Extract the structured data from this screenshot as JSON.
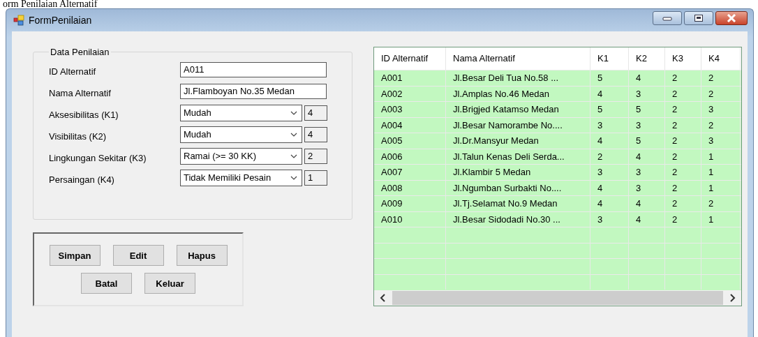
{
  "caption": "orm Penilaian Alternatif",
  "window": {
    "title": "FormPenilaian"
  },
  "group": {
    "title": "Data Penilaian",
    "fields": [
      {
        "kind": "text",
        "label": "ID Alternatif",
        "value": "A011"
      },
      {
        "kind": "text",
        "label": "Nama Alternatif",
        "value": "Jl.Flamboyan No.35 Medan"
      },
      {
        "kind": "combo",
        "label": "Aksesibilitas (K1)",
        "value": "Mudah",
        "score": "4"
      },
      {
        "kind": "combo",
        "label": "Visibilitas (K2)",
        "value": "Mudah",
        "score": "4"
      },
      {
        "kind": "combo",
        "label": "Lingkungan Sekitar (K3)",
        "value": "Ramai (>= 30 KK)",
        "score": "2"
      },
      {
        "kind": "combo",
        "label": "Persaingan (K4)",
        "value": "Tidak Memiliki Pesain",
        "score": "1"
      }
    ]
  },
  "buttons": [
    [
      "Simpan",
      "Edit",
      "Hapus"
    ],
    [
      "Batal",
      "Keluar"
    ]
  ],
  "table": {
    "columns": [
      "ID Alternatif",
      "Nama Alternatif",
      "K1",
      "K2",
      "K3",
      "K4"
    ],
    "rows": [
      [
        "A001",
        "Jl.Besar Deli Tua No.58 ...",
        "5",
        "4",
        "2",
        "2"
      ],
      [
        "A002",
        "Jl.Amplas No.46 Medan",
        "4",
        "3",
        "2",
        "2"
      ],
      [
        "A003",
        "Jl.Brigjed Katamso Medan",
        "5",
        "5",
        "2",
        "3"
      ],
      [
        "A004",
        "Jl.Besar Namorambe No....",
        "3",
        "3",
        "2",
        "2"
      ],
      [
        "A005",
        "Jl.Dr.Mansyur Medan",
        "4",
        "5",
        "2",
        "3"
      ],
      [
        "A006",
        "Jl.Talun Kenas Deli Serda...",
        "2",
        "4",
        "2",
        "1"
      ],
      [
        "A007",
        "Jl.Klambir 5 Medan",
        "3",
        "3",
        "2",
        "1"
      ],
      [
        "A008",
        "Jl.Ngumban Surbakti No....",
        "4",
        "3",
        "2",
        "1"
      ],
      [
        "A009",
        "Jl.Tj.Selamat No.9 Medan",
        "4",
        "4",
        "2",
        "2"
      ],
      [
        "A010",
        "Jl.Besar Sidodadi No.30 ...",
        "3",
        "4",
        "2",
        "1"
      ]
    ]
  }
}
